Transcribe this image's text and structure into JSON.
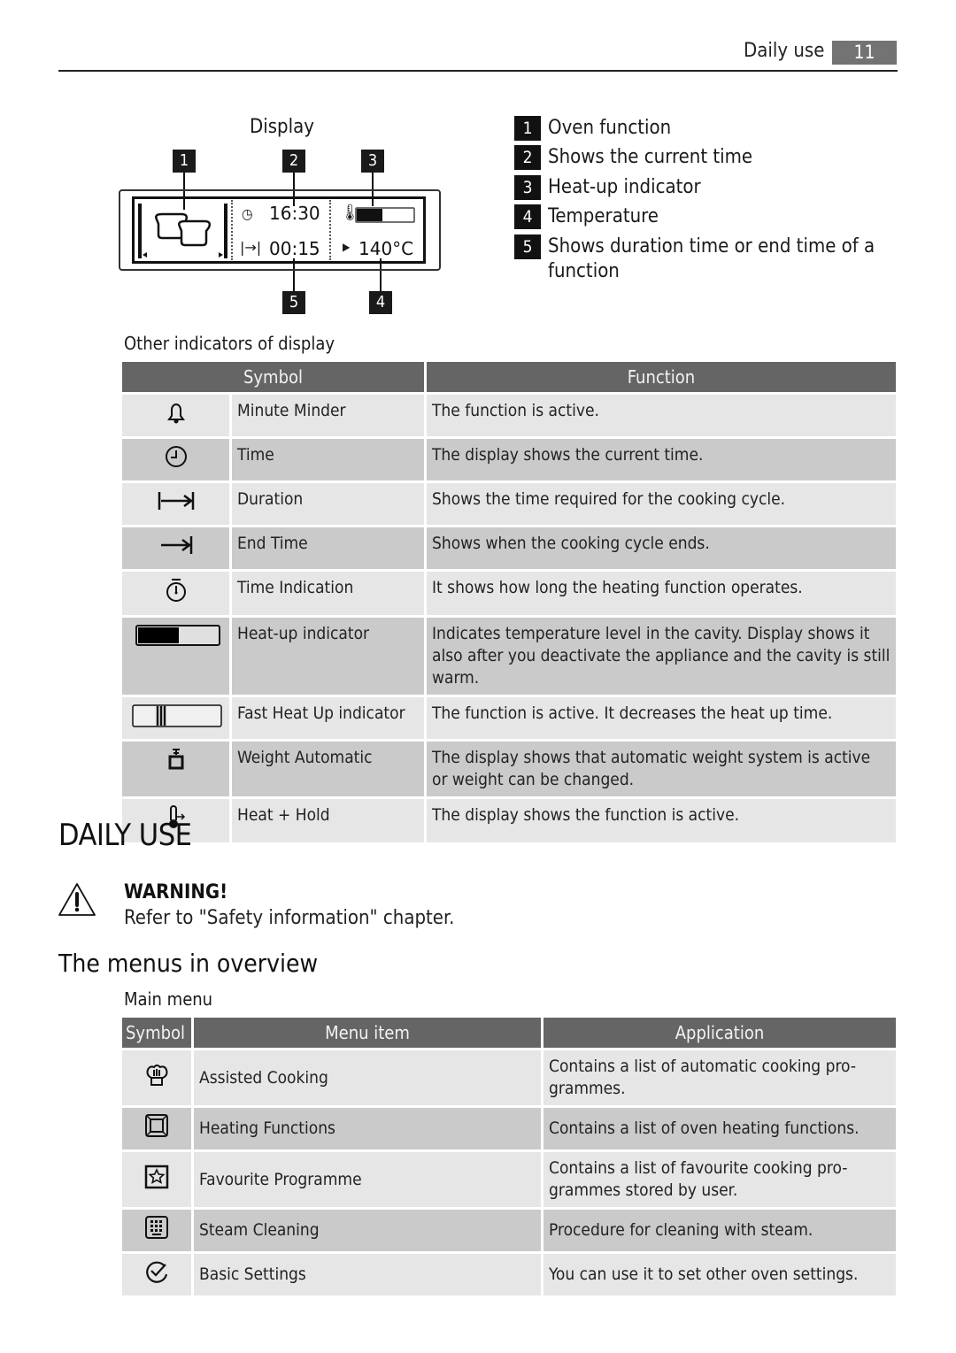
{
  "header": {
    "section_title": "Daily use",
    "page_number": "11"
  },
  "display_figure": {
    "title": "Display",
    "callouts": [
      "1",
      "2",
      "3",
      "4",
      "5"
    ],
    "current_time": "16:30",
    "duration_time": "00:15",
    "temperature": "140°C",
    "heatup_level_fraction": 0.45
  },
  "legend": [
    {
      "num": "1",
      "text": "Oven function"
    },
    {
      "num": "2",
      "text": "Shows the current time"
    },
    {
      "num": "3",
      "text": "Heat-up indicator"
    },
    {
      "num": "4",
      "text": "Temperature"
    },
    {
      "num": "5",
      "text": "Shows duration time or end time of a function"
    }
  ],
  "other_indicators": {
    "caption": "Other indicators of display",
    "headers": {
      "symbol": "Symbol",
      "function": "Function"
    },
    "rows": [
      {
        "icon": "bell-icon",
        "name": "Minute Minder",
        "function": "The function is active."
      },
      {
        "icon": "clock-icon",
        "name": "Time",
        "function": "The display shows the current time."
      },
      {
        "icon": "duration-icon",
        "name": "Duration",
        "function": "Shows the time required for the cooking cycle."
      },
      {
        "icon": "end-time-icon",
        "name": "End Time",
        "function": "Shows when the cooking cycle ends."
      },
      {
        "icon": "stopwatch-icon",
        "name": "Time Indication",
        "function": "It shows how long the heating function operates."
      },
      {
        "icon": "heatup-bar-icon",
        "name": "Heat-up indicator",
        "function": "Indicates temperature level in the cavity. Display shows it also after you deactivate the appliance and the cavity is still warm."
      },
      {
        "icon": "fast-heatup-icon",
        "name": "Fast Heat Up indicator",
        "function": "The function is active. It decreases the heat up time."
      },
      {
        "icon": "weight-icon",
        "name": "Weight Automatic",
        "function": "The display shows that automatic weight system is active or weight can be changed."
      },
      {
        "icon": "heat-hold-icon",
        "name": "Heat + Hold",
        "function": "The display shows the function is active."
      }
    ]
  },
  "daily_use": {
    "title": "DAILY USE",
    "warning_title": "WARNING!",
    "warning_text": "Refer to \"Safety information\" chapter.",
    "menus_heading": "The menus in overview",
    "main_menu_caption": "Main menu",
    "headers": {
      "symbol": "Symbol",
      "item": "Menu item",
      "application": "Application"
    },
    "rows": [
      {
        "icon": "chef-hat-icon",
        "item": "Assisted Cooking",
        "application": "Contains a list of automatic cooking pro- grammes."
      },
      {
        "icon": "oven-icon",
        "item": "Heating Functions",
        "application": "Contains a list of oven heating functions."
      },
      {
        "icon": "star-box-icon",
        "item": "Favourite Programme",
        "application": "Contains a list of favourite cooking pro- grammes stored by user."
      },
      {
        "icon": "steam-grid-icon",
        "item": "Steam Cleaning",
        "application": "Procedure for cleaning with steam."
      },
      {
        "icon": "check-circle-icon",
        "item": "Basic Settings",
        "application": "You can use it to set other oven settings."
      }
    ]
  }
}
